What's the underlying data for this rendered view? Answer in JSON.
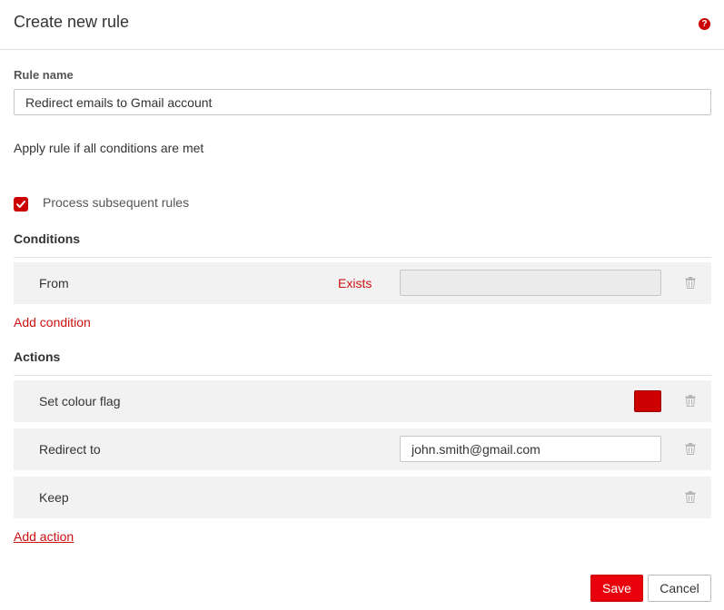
{
  "dialog": {
    "title": "Create new rule",
    "help_label": "?"
  },
  "rule_name": {
    "label": "Rule name",
    "value": "Redirect emails to Gmail account"
  },
  "apply_text": "Apply rule if all conditions are met",
  "process_subsequent": {
    "label": "Process subsequent rules",
    "checked": true
  },
  "conditions": {
    "title": "Conditions",
    "items": [
      {
        "field": "From",
        "operator": "Exists",
        "value": ""
      }
    ],
    "add_label": "Add condition"
  },
  "actions": {
    "title": "Actions",
    "items": [
      {
        "label": "Set colour flag",
        "colour": "#cc0000"
      },
      {
        "label": "Redirect to",
        "value": "john.smith@gmail.com"
      },
      {
        "label": "Keep"
      }
    ],
    "add_label": "Add action"
  },
  "buttons": {
    "save": "Save",
    "cancel": "Cancel"
  },
  "colors": {
    "accent": "#cc0000",
    "row_background": "#f2f2f2"
  },
  "icons": {
    "help": "help-icon",
    "check": "check-icon",
    "delete": "trash-icon"
  }
}
